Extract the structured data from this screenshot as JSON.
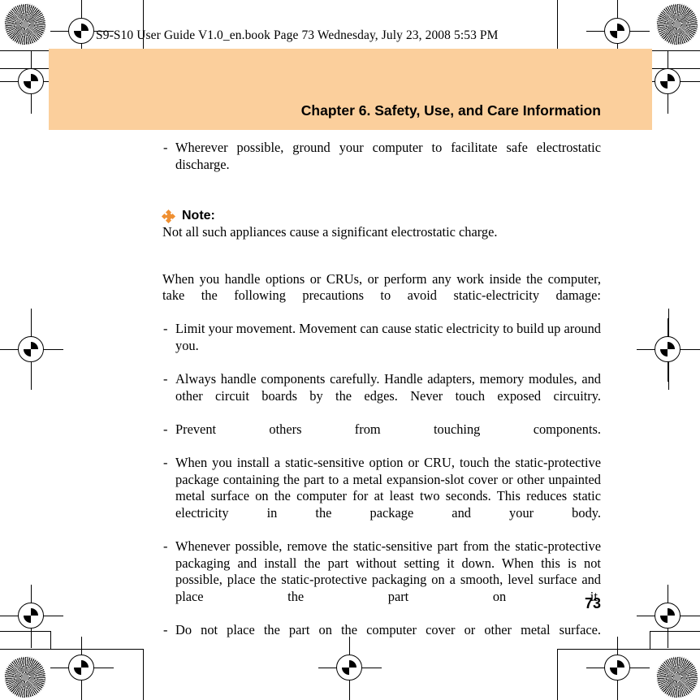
{
  "header": {
    "file_info": "S9-S10 User Guide V1.0_en.book  Page 73  Wednesday, July 23, 2008  5:53 PM"
  },
  "banner": {
    "chapter_title": "Chapter 6. Safety, Use, and Care Information",
    "background_color": "#fbcf9c"
  },
  "content": {
    "top_bullet": {
      "dash": "-",
      "text": "Wherever possible, ground your computer to facilitate safe electrostatic discharge."
    },
    "note": {
      "bullet_icon": "orange-diamond-cluster-icon",
      "bullet_color": "#ef9033",
      "label": "Note:",
      "body": "Not all such appliances cause a significant electrostatic charge."
    },
    "intro_paragraph": "When you handle options or CRUs, or perform any work inside the computer, take the following precautions to avoid static-electricity damage:",
    "dash": "-",
    "list_items": [
      "Limit your movement. Movement can cause static electricity to build up around you.",
      "Always handle components carefully. Handle adapters, memory modules, and other circuit boards by the edges. Never touch exposed circuitry.",
      "Prevent others from touching components.",
      "When you install a static-sensitive option or CRU, touch the static-protective package containing the part to a metal expansion-slot cover or other unpainted metal surface on the computer for at least two seconds. This reduces static electricity in the package and your body.",
      "Whenever possible, remove the static-sensitive part from the static-protective packaging and install the part without setting it down. When this is not possible, place the static-protective packaging on a smooth, level surface and place the part on it.",
      "Do not place the part on the computer cover or other metal surface."
    ]
  },
  "footer": {
    "page_number": "73"
  }
}
